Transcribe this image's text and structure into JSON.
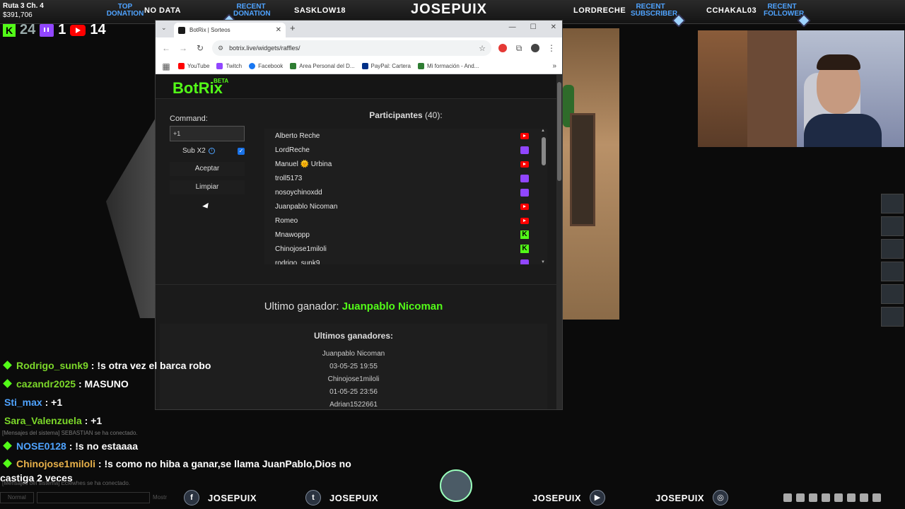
{
  "stats": {
    "route": "Ruta 3 Ch. 4",
    "money": "$391,706",
    "kick_count": "24",
    "twitch_count": "1",
    "youtube_count": "14"
  },
  "top_bar": {
    "top_donation_label": "TOP DONATION",
    "top_donation_value": "NO DATA",
    "recent_donation_label": "RECENT DONATION",
    "recent_donation_value": "SASKLOW18",
    "streamer": "JOSEPUIX",
    "lordreche": "LORDRECHE",
    "recent_subscriber_label": "RECENT SUBSCRIBER",
    "recent_subscriber_value": "CCHAKAL03",
    "recent_follower_label": "RECENT FOLLOWER"
  },
  "browser": {
    "tab_title": "BotRix | Sorteos",
    "url": "botrix.live/widgets/raffles/",
    "bookmarks": [
      {
        "label": "YouTube",
        "color": "#ff0000"
      },
      {
        "label": "Twitch",
        "color": "#9146ff"
      },
      {
        "label": "Facebook",
        "color": "#1877f2"
      },
      {
        "label": "Area Personal del D...",
        "color": "#2e7d32"
      },
      {
        "label": "PayPal: Cartera",
        "color": "#003087"
      },
      {
        "label": "Mi formación - And...",
        "color": "#2e7d32"
      }
    ]
  },
  "botrix": {
    "logo": "BotRix",
    "beta": "BETA",
    "command_label": "Command:",
    "command_value": "+1",
    "sub_x2_label": "Sub X2",
    "accept_label": "Aceptar",
    "clear_label": "Limpiar",
    "participants_label": "Participantes",
    "participants_count": "(40):",
    "participants": [
      {
        "name": "Alberto Reche",
        "platform": "youtube"
      },
      {
        "name": "LordReche",
        "platform": "twitch"
      },
      {
        "name": "Manuel 🌞 Urbina",
        "platform": "youtube"
      },
      {
        "name": "troll5173",
        "platform": "twitch"
      },
      {
        "name": "nosoychinoxdd",
        "platform": "twitch"
      },
      {
        "name": "Juanpablo Nicoman",
        "platform": "youtube"
      },
      {
        "name": "Romeo",
        "platform": "youtube"
      },
      {
        "name": "Mnawoppp",
        "platform": "kick"
      },
      {
        "name": "Chinojose1miloli",
        "platform": "kick"
      },
      {
        "name": "rodrigo_sunk9",
        "platform": "twitch"
      }
    ],
    "last_winner_label": "Ultimo ganador:",
    "last_winner_name": "Juanpablo Nicoman",
    "winners_title": "Ultimos ganadores:",
    "winners": [
      {
        "name": "Juanpablo Nicoman",
        "date": "03-05-25 19:55"
      },
      {
        "name": "Chinojose1miloli",
        "date": "01-05-25 23:56"
      },
      {
        "name": "Adrian1522661",
        "date": ""
      }
    ]
  },
  "chat": [
    {
      "user": "Rodrigo_sunk9",
      "text": " : !s otra vez el barca robo",
      "color": "green",
      "gem": true
    },
    {
      "user": "cazandr2025",
      "text": " : MASUNO",
      "color": "green",
      "gem": true
    },
    {
      "user": "Sti_max",
      "text": " : +1",
      "color": "blue",
      "gem": false
    },
    {
      "user": "Sara_Valenzuela",
      "text": " : +1",
      "color": "green",
      "gem": false
    }
  ],
  "chat2": [
    {
      "user": "NOSE0128",
      "text": " : !s no estaaaa",
      "color": "blue",
      "gem": true
    }
  ],
  "chat_long": {
    "user": "Chinojose1miloli",
    "text": " : !s como no hiba a ganar,se llama JuanPablo,Dios no castiga 2 veces"
  },
  "chat_sys_1": "[Mensajes del sistema] SEBASTIAN se ha conectado.",
  "chat_sys_2": "[Mensajes del sistema] Eclewhes se ha conectado.",
  "chat_input": {
    "mode": "Normal",
    "show": "Mostr"
  },
  "bottom_bar": {
    "facebook": "JOSEPUIX",
    "twitter": "JOSEPUIX",
    "youtube": "JOSEPUIX",
    "instagram": "JOSEPUIX"
  }
}
